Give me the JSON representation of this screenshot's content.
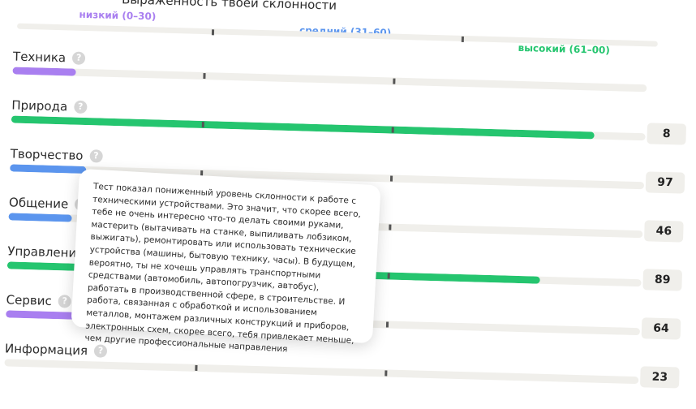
{
  "heading": "Выраженность твоей склонности",
  "legend": [
    {
      "label": "низкий (0–30)",
      "color": "#a97ff0"
    },
    {
      "label": "средний (31–60)",
      "color": "#5b95ee"
    },
    {
      "label": "высокий (61–00)",
      "color": "#25c56f"
    }
  ],
  "rows": [
    {
      "label": "Техника",
      "score": "",
      "level": 10,
      "color": "#a97ff0"
    },
    {
      "label": "Природа",
      "score": "8",
      "level": 92,
      "color": "#25c56f"
    },
    {
      "label": "Творчество",
      "score": "97",
      "level": 12,
      "color": "#5b95ee"
    },
    {
      "label": "Общение",
      "score": "46",
      "level": 10,
      "color": "#5b95ee"
    },
    {
      "label": "Управление",
      "score": "89",
      "level": 84,
      "color": "#25c56f"
    },
    {
      "label": "Сервис",
      "score": "64",
      "level": 11,
      "color": "#a97ff0"
    },
    {
      "label": "Информация",
      "score": "23",
      "level": 0,
      "color": "#a97ff0"
    }
  ],
  "tooltip": {
    "text": "Тест показал пониженный уровень склонности к работе с техническими устройствами. Это значит, что скорее всего, тебе не очень интересно что-то делать своими руками, мастерить (вытачивать на станке, выпиливать лобзиком, выжигать), ремонтировать или использовать технические устройства (машины, бытовую технику, часы). В будущем, вероятно, ты не хочешь управлять транспортными средствами (автомобиль, автопогрузчик, автобус), работать в производственной сфере, в строительстве. И работа, связанная с обработкой и использованием металлов, монтажем различных конструкций и приборов, электронных схем, скорее всего, тебя привлекает меньше, чем другие профессиональные направления"
  },
  "help_icon_glyph": "?"
}
